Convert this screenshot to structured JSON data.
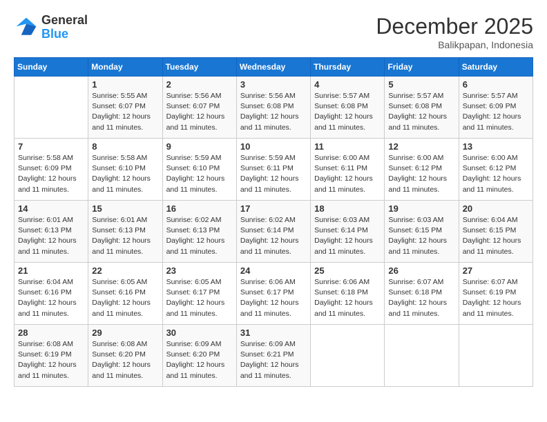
{
  "logo": {
    "line1": "General",
    "line2": "Blue"
  },
  "title": "December 2025",
  "location": "Balikpapan, Indonesia",
  "weekdays": [
    "Sunday",
    "Monday",
    "Tuesday",
    "Wednesday",
    "Thursday",
    "Friday",
    "Saturday"
  ],
  "weeks": [
    [
      {
        "day": "",
        "info": ""
      },
      {
        "day": "1",
        "info": "Sunrise: 5:55 AM\nSunset: 6:07 PM\nDaylight: 12 hours\nand 11 minutes."
      },
      {
        "day": "2",
        "info": "Sunrise: 5:56 AM\nSunset: 6:07 PM\nDaylight: 12 hours\nand 11 minutes."
      },
      {
        "day": "3",
        "info": "Sunrise: 5:56 AM\nSunset: 6:08 PM\nDaylight: 12 hours\nand 11 minutes."
      },
      {
        "day": "4",
        "info": "Sunrise: 5:57 AM\nSunset: 6:08 PM\nDaylight: 12 hours\nand 11 minutes."
      },
      {
        "day": "5",
        "info": "Sunrise: 5:57 AM\nSunset: 6:08 PM\nDaylight: 12 hours\nand 11 minutes."
      },
      {
        "day": "6",
        "info": "Sunrise: 5:57 AM\nSunset: 6:09 PM\nDaylight: 12 hours\nand 11 minutes."
      }
    ],
    [
      {
        "day": "7",
        "info": "Sunrise: 5:58 AM\nSunset: 6:09 PM\nDaylight: 12 hours\nand 11 minutes."
      },
      {
        "day": "8",
        "info": "Sunrise: 5:58 AM\nSunset: 6:10 PM\nDaylight: 12 hours\nand 11 minutes."
      },
      {
        "day": "9",
        "info": "Sunrise: 5:59 AM\nSunset: 6:10 PM\nDaylight: 12 hours\nand 11 minutes."
      },
      {
        "day": "10",
        "info": "Sunrise: 5:59 AM\nSunset: 6:11 PM\nDaylight: 12 hours\nand 11 minutes."
      },
      {
        "day": "11",
        "info": "Sunrise: 6:00 AM\nSunset: 6:11 PM\nDaylight: 12 hours\nand 11 minutes."
      },
      {
        "day": "12",
        "info": "Sunrise: 6:00 AM\nSunset: 6:12 PM\nDaylight: 12 hours\nand 11 minutes."
      },
      {
        "day": "13",
        "info": "Sunrise: 6:00 AM\nSunset: 6:12 PM\nDaylight: 12 hours\nand 11 minutes."
      }
    ],
    [
      {
        "day": "14",
        "info": "Sunrise: 6:01 AM\nSunset: 6:13 PM\nDaylight: 12 hours\nand 11 minutes."
      },
      {
        "day": "15",
        "info": "Sunrise: 6:01 AM\nSunset: 6:13 PM\nDaylight: 12 hours\nand 11 minutes."
      },
      {
        "day": "16",
        "info": "Sunrise: 6:02 AM\nSunset: 6:13 PM\nDaylight: 12 hours\nand 11 minutes."
      },
      {
        "day": "17",
        "info": "Sunrise: 6:02 AM\nSunset: 6:14 PM\nDaylight: 12 hours\nand 11 minutes."
      },
      {
        "day": "18",
        "info": "Sunrise: 6:03 AM\nSunset: 6:14 PM\nDaylight: 12 hours\nand 11 minutes."
      },
      {
        "day": "19",
        "info": "Sunrise: 6:03 AM\nSunset: 6:15 PM\nDaylight: 12 hours\nand 11 minutes."
      },
      {
        "day": "20",
        "info": "Sunrise: 6:04 AM\nSunset: 6:15 PM\nDaylight: 12 hours\nand 11 minutes."
      }
    ],
    [
      {
        "day": "21",
        "info": "Sunrise: 6:04 AM\nSunset: 6:16 PM\nDaylight: 12 hours\nand 11 minutes."
      },
      {
        "day": "22",
        "info": "Sunrise: 6:05 AM\nSunset: 6:16 PM\nDaylight: 12 hours\nand 11 minutes."
      },
      {
        "day": "23",
        "info": "Sunrise: 6:05 AM\nSunset: 6:17 PM\nDaylight: 12 hours\nand 11 minutes."
      },
      {
        "day": "24",
        "info": "Sunrise: 6:06 AM\nSunset: 6:17 PM\nDaylight: 12 hours\nand 11 minutes."
      },
      {
        "day": "25",
        "info": "Sunrise: 6:06 AM\nSunset: 6:18 PM\nDaylight: 12 hours\nand 11 minutes."
      },
      {
        "day": "26",
        "info": "Sunrise: 6:07 AM\nSunset: 6:18 PM\nDaylight: 12 hours\nand 11 minutes."
      },
      {
        "day": "27",
        "info": "Sunrise: 6:07 AM\nSunset: 6:19 PM\nDaylight: 12 hours\nand 11 minutes."
      }
    ],
    [
      {
        "day": "28",
        "info": "Sunrise: 6:08 AM\nSunset: 6:19 PM\nDaylight: 12 hours\nand 11 minutes."
      },
      {
        "day": "29",
        "info": "Sunrise: 6:08 AM\nSunset: 6:20 PM\nDaylight: 12 hours\nand 11 minutes."
      },
      {
        "day": "30",
        "info": "Sunrise: 6:09 AM\nSunset: 6:20 PM\nDaylight: 12 hours\nand 11 minutes."
      },
      {
        "day": "31",
        "info": "Sunrise: 6:09 AM\nSunset: 6:21 PM\nDaylight: 12 hours\nand 11 minutes."
      },
      {
        "day": "",
        "info": ""
      },
      {
        "day": "",
        "info": ""
      },
      {
        "day": "",
        "info": ""
      }
    ]
  ]
}
